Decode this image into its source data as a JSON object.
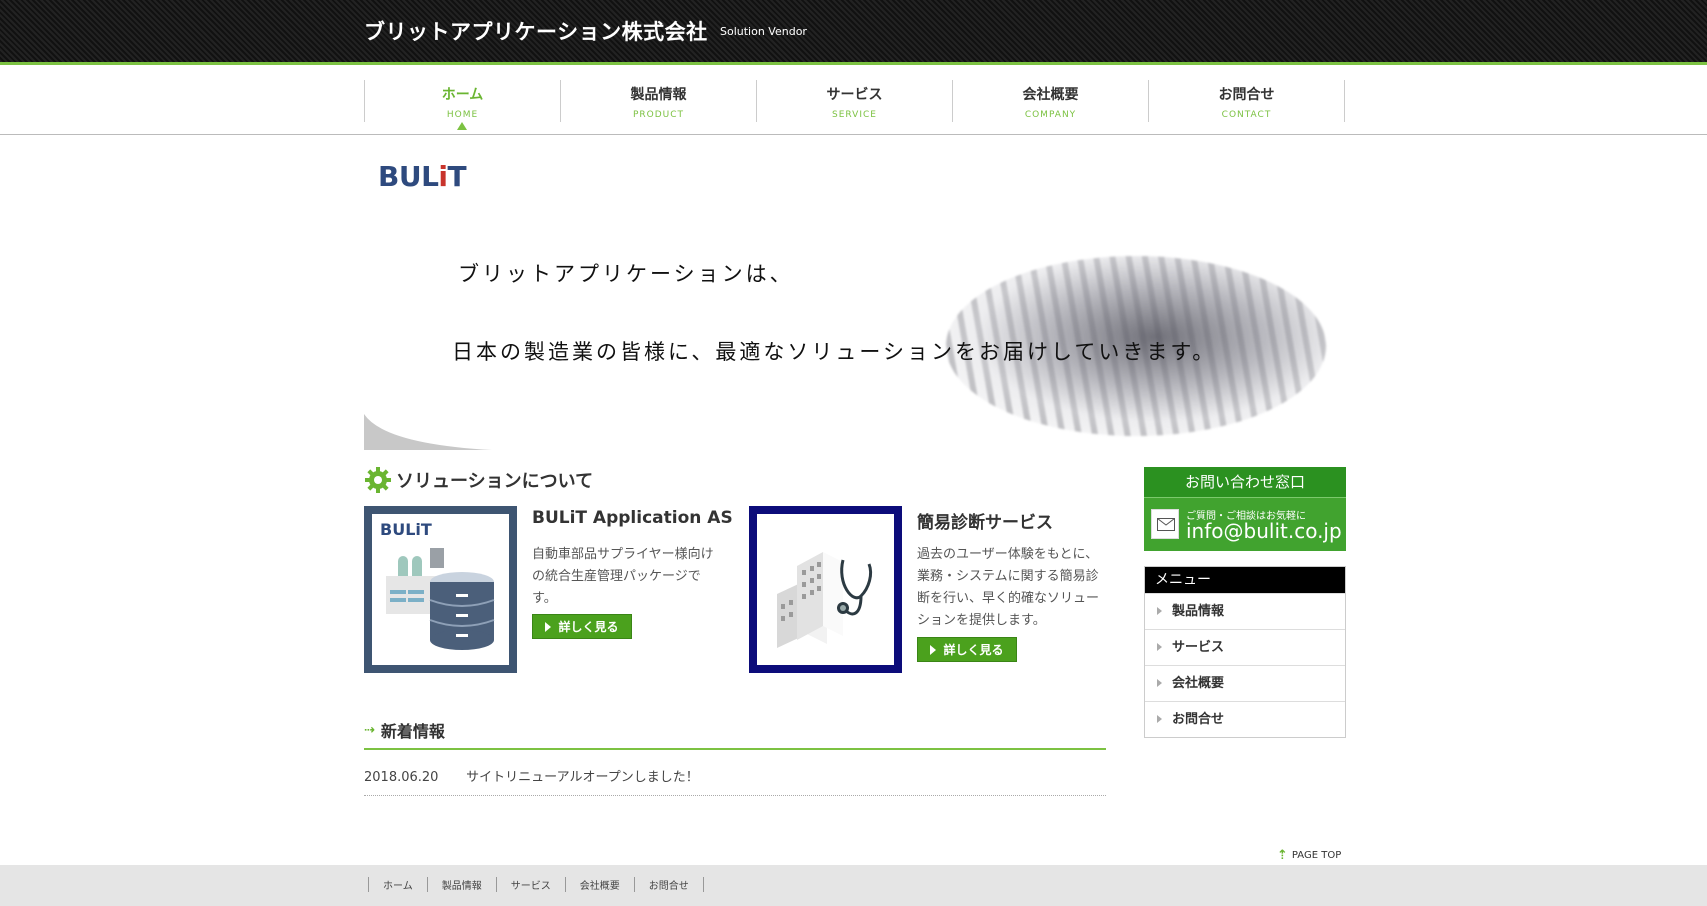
{
  "header": {
    "brand": "ブリットアプリケーション株式会社",
    "tagline": "Solution Vendor"
  },
  "nav": [
    {
      "jp": "ホーム",
      "en": "HOME"
    },
    {
      "jp": "製品情報",
      "en": "PRODUCT"
    },
    {
      "jp": "サービス",
      "en": "SERVICE"
    },
    {
      "jp": "会社概要",
      "en": "COMPANY"
    },
    {
      "jp": "お問合せ",
      "en": "CONTACT"
    }
  ],
  "hero": {
    "logo_a": "BUL",
    "logo_i": "i",
    "logo_b": "T",
    "line1": "ブリットアプリケーションは、",
    "line2": "日本の製造業の皆様に、最適なソリューションをお届けしていきます。"
  },
  "solutions": {
    "title": "ソリューションについて",
    "cards": [
      {
        "image_logo": "BULiT",
        "title": "BULiT Application AS",
        "desc": "自動車部品サプライヤー様向けの統合生産管理パッケージです。",
        "button": "詳しく見る"
      },
      {
        "title": "簡易診断サービス",
        "desc": "過去のユーザー体験をもとに、業務・システムに関する簡易診断を行い、早く的確なソリューションを提供します。",
        "button": "詳しく見る"
      }
    ]
  },
  "news": {
    "title": "新着情報",
    "items": [
      {
        "date": "2018.06.20",
        "text": "サイトリニューアルオープンしました！"
      }
    ]
  },
  "contact": {
    "heading": "お問い合わせ窓口",
    "sub": "ご質問・ご相談はお気軽に",
    "email": "info@bulit.co.jp"
  },
  "menu": {
    "heading": "メニュー",
    "items": [
      "製品情報",
      "サービス",
      "会社概要",
      "お問合せ"
    ]
  },
  "pagetop": "PAGE TOP",
  "footer_nav": [
    "ホーム",
    "製品情報",
    "サービス",
    "会社概要",
    "お問合せ"
  ],
  "colors": {
    "accent": "#7cc242",
    "button": "#4ba11d",
    "contact": "#41a32f",
    "header_bg": "#1a1a1a"
  }
}
